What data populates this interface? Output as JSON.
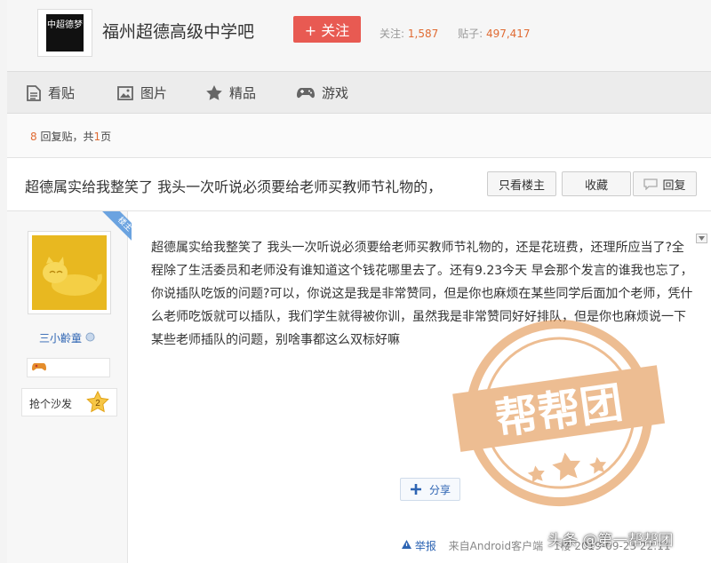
{
  "forum": {
    "name": "福州超德高级中学吧",
    "logo_text": "中超德梦",
    "follow_label": "+ 关注",
    "followers_label": "关注:",
    "followers": "1,587",
    "posts_label": "贴子:",
    "posts": "497,417"
  },
  "nav": {
    "items": [
      {
        "label": "看贴",
        "icon": "document-icon"
      },
      {
        "label": "图片",
        "icon": "image-icon"
      },
      {
        "label": "精品",
        "icon": "star-icon"
      },
      {
        "label": "游戏",
        "icon": "gamepad-icon"
      }
    ]
  },
  "thread_info": {
    "reply_count": "8",
    "reply_text": " 回复贴，共",
    "page_count": "1",
    "page_suffix": "页"
  },
  "thread": {
    "title": "超德属实给我整笑了 我头一次听说必须要给老师买教师节礼物的，",
    "only_op_label": "只看楼主",
    "collect_label": "收藏",
    "reply_label": "回复"
  },
  "post": {
    "op_badge": "楼主",
    "username": "三小齡童",
    "sofa_label": "抢个沙发",
    "sofa_count": "2",
    "body": "超德属实给我整笑了 我头一次听说必须要给老师买教师节礼物的，还是花班费，还理所应当了?全程除了生活委员和老师没有谁知道这个钱花哪里去了。还有9.23今天 早会那个发言的谁我也忘了，你说插队吃饭的问题?可以，你说这是我是非常赞同，但是你也麻烦在某些同学后面加个老师，凭什么老师吃饭就可以插队，我们学生就得被你训，虽然我是非常赞同好好排队，但是你也麻烦说一下某些老师插队的问题，别啥事都这么双标好嘛",
    "share_label": "分享",
    "report_label": "举报",
    "client_label": "来自Android客户端",
    "floor_label": "1楼 2019-09-23 22:11"
  },
  "stamp": {
    "text": "帮帮团"
  },
  "watermark": "头条 @第一帮帮团",
  "colors": {
    "accent_red": "#e85a52",
    "highlight_orange": "#e06b33",
    "link_blue": "#2d64b3",
    "stamp_orange": "#e0883a"
  }
}
